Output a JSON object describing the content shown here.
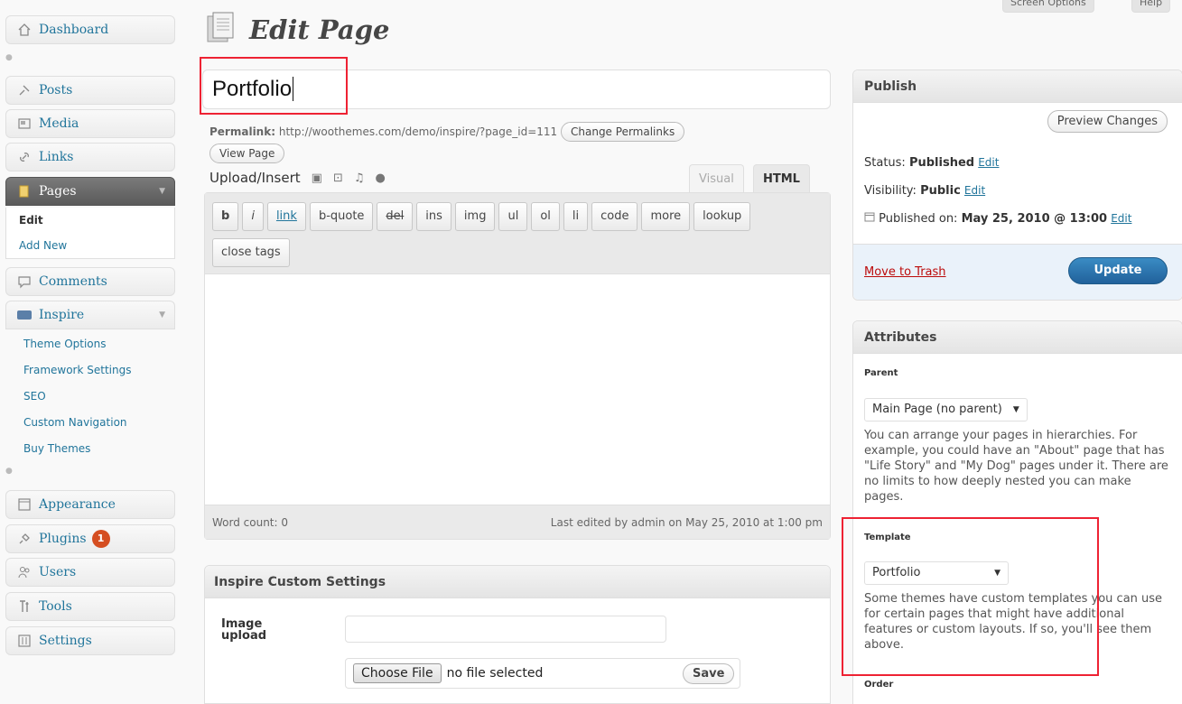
{
  "header": {
    "title": "Edit Page",
    "screen_options": "Screen Options",
    "help": "Help"
  },
  "sidebar": {
    "dashboard": "Dashboard",
    "posts": "Posts",
    "media": "Media",
    "links": "Links",
    "pages": "Pages",
    "pages_sub": [
      "Edit",
      "Add New"
    ],
    "comments": "Comments",
    "inspire": "Inspire",
    "inspire_sub": [
      "Theme Options",
      "Framework Settings",
      "SEO",
      "Custom Navigation",
      "Buy Themes"
    ],
    "appearance": "Appearance",
    "plugins": "Plugins",
    "plugins_badge": "1",
    "users": "Users",
    "tools": "Tools",
    "settings": "Settings"
  },
  "editor": {
    "title_value": "Portfolio",
    "permalink_label": "Permalink:",
    "permalink_url": "http://woothemes.com/demo/inspire/?page_id=111",
    "change_permalinks": "Change Permalinks",
    "view_page": "View Page",
    "upload_insert": "Upload/Insert",
    "tab_visual": "Visual",
    "tab_html": "HTML",
    "quicktags": [
      "b",
      "i",
      "link",
      "b-quote",
      "del",
      "ins",
      "img",
      "ul",
      "ol",
      "li",
      "code",
      "more",
      "lookup",
      "close tags"
    ],
    "word_count": "Word count: 0",
    "last_edited": "Last edited by admin on May 25, 2010 at 1:00 pm"
  },
  "custom_settings": {
    "title": "Inspire Custom Settings",
    "image_label": "Image upload",
    "choose_file": "Choose File",
    "no_file": "no file selected",
    "save": "Save"
  },
  "publish": {
    "title": "Publish",
    "preview": "Preview Changes",
    "status_label": "Status:",
    "status_value": "Published",
    "visibility_label": "Visibility:",
    "visibility_value": "Public",
    "published_label": "Published on:",
    "published_value": "May 25, 2010 @ 13:00",
    "edit": "Edit",
    "trash": "Move to Trash",
    "update": "Update"
  },
  "attributes": {
    "title": "Attributes",
    "parent_label": "Parent",
    "parent_value": "Main Page (no parent)",
    "parent_help": "You can arrange your pages in hierarchies. For example, you could have an \"About\" page that has \"Life Story\" and \"My Dog\" pages under it. There are no limits to how deeply nested you can make pages.",
    "template_label": "Template",
    "template_value": "Portfolio",
    "template_help": "Some themes have custom templates you can use for certain pages that might have additional features or custom layouts. If so, you'll see them above.",
    "order_label": "Order"
  }
}
